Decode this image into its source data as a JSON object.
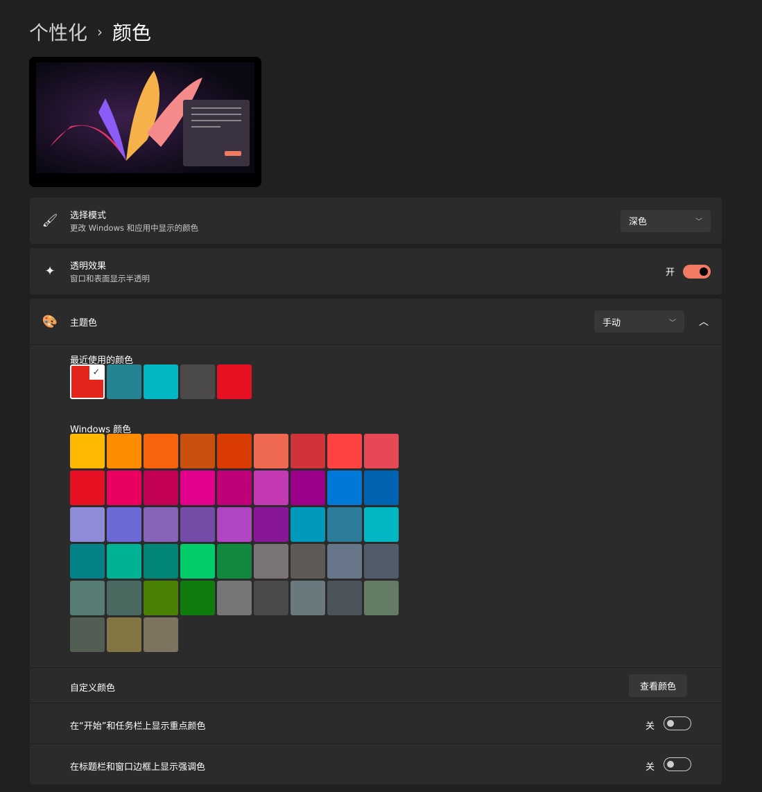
{
  "breadcrumb": {
    "parent": "个性化",
    "current": "颜色"
  },
  "mode": {
    "title": "选择模式",
    "desc": "更改 Windows 和应用中显示的颜色",
    "value": "深色"
  },
  "transparency": {
    "title": "透明效果",
    "desc": "窗口和表面显示半透明",
    "state": "开"
  },
  "accent": {
    "title": "主题色",
    "value": "手动"
  },
  "recent": {
    "label": "最近使用的颜色",
    "colors": [
      "#E3251C",
      "#258394",
      "#00B7C3",
      "#4C4A48",
      "#E81123"
    ]
  },
  "windows_colors": {
    "label": "Windows 颜色",
    "colors": [
      "#FFB900",
      "#FF8C00",
      "#F7630C",
      "#CA5010",
      "#DA3B01",
      "#EF6950",
      "#D13438",
      "#FF4343",
      "#E74856",
      "#E81123",
      "#EA005E",
      "#C30052",
      "#E3008C",
      "#BF0077",
      "#C239B3",
      "#9A0089",
      "#0078D7",
      "#0063B1",
      "#8E8CD8",
      "#6B69D6",
      "#8764B8",
      "#744DA9",
      "#B146C2",
      "#881798",
      "#0099BC",
      "#2D7D9A",
      "#00B7C3",
      "#038387",
      "#00B294",
      "#018574",
      "#00CC6A",
      "#10893E",
      "#7A7574",
      "#5D5A58",
      "#68768A",
      "#515C6B",
      "#567C73",
      "#486860",
      "#498205",
      "#107C10",
      "#767676",
      "#4C4A48",
      "#69797E",
      "#4A5459",
      "#647C64",
      "#525E54",
      "#847545",
      "#7E735F"
    ]
  },
  "custom": {
    "label": "自定义颜色",
    "button": "查看颜色"
  },
  "start_taskbar": {
    "label": "在“开始”和任务栏上显示重点颜色",
    "state": "关"
  },
  "title_bars": {
    "label": "在标题栏和窗口边框上显示强调色",
    "state": "关"
  }
}
